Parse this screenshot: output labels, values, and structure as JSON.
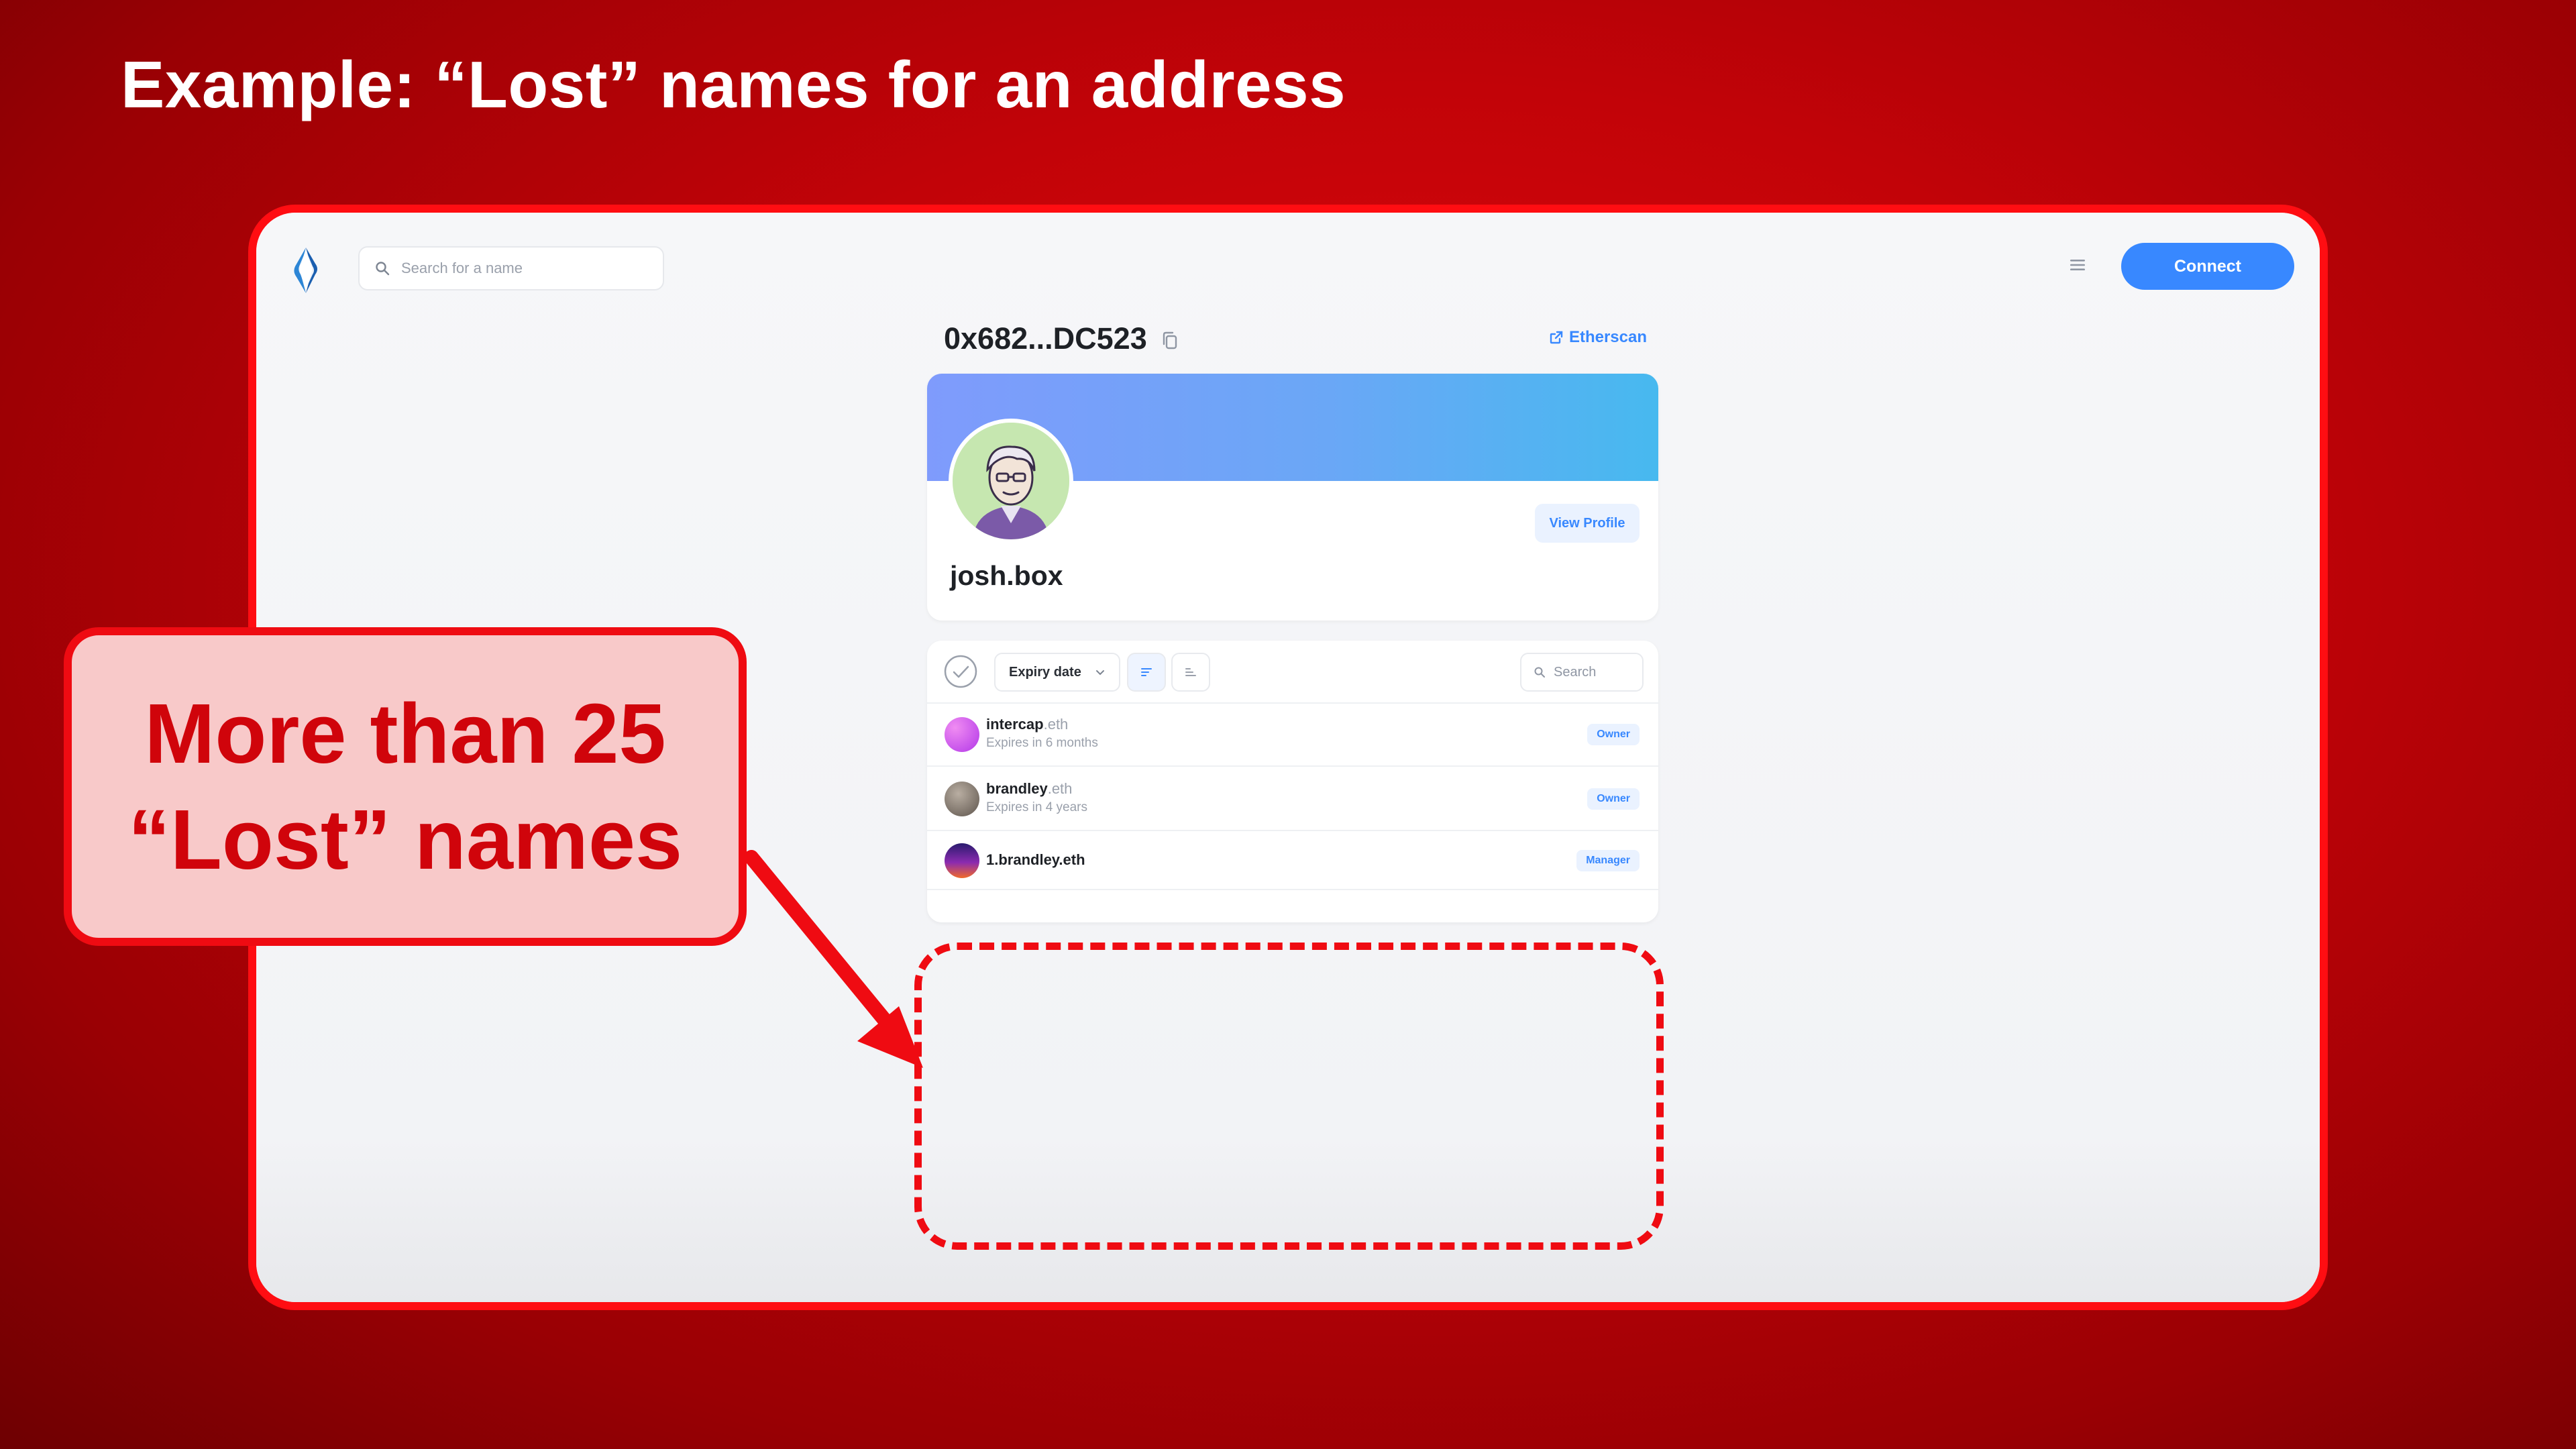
{
  "slide": {
    "title": "Example: “Lost” names for an address"
  },
  "app": {
    "search_placeholder": "Search for a name",
    "connect_label": "Connect",
    "address": "0x682...DC523",
    "etherscan_label": "Etherscan",
    "accent_color": "#3888ff"
  },
  "profile": {
    "name": "josh.box",
    "view_profile_label": "View Profile"
  },
  "names_list": {
    "sort_label": "Expiry date",
    "search_placeholder": "Search",
    "rows": [
      {
        "label": "intercap",
        "tld": ".eth",
        "expiry": "Expires in 6 months",
        "role": "Owner"
      },
      {
        "label": "brandley",
        "tld": ".eth",
        "expiry": "Expires in 4 years",
        "role": "Owner"
      },
      {
        "label": "1.brandley.eth",
        "tld": "",
        "expiry": "",
        "role": "Manager"
      }
    ]
  },
  "callout": {
    "line1": "More than 25",
    "line2": "“Lost” names"
  },
  "colors": {
    "highlight_red": "#ef0b12",
    "callout_fill": "#f8c9c9"
  }
}
